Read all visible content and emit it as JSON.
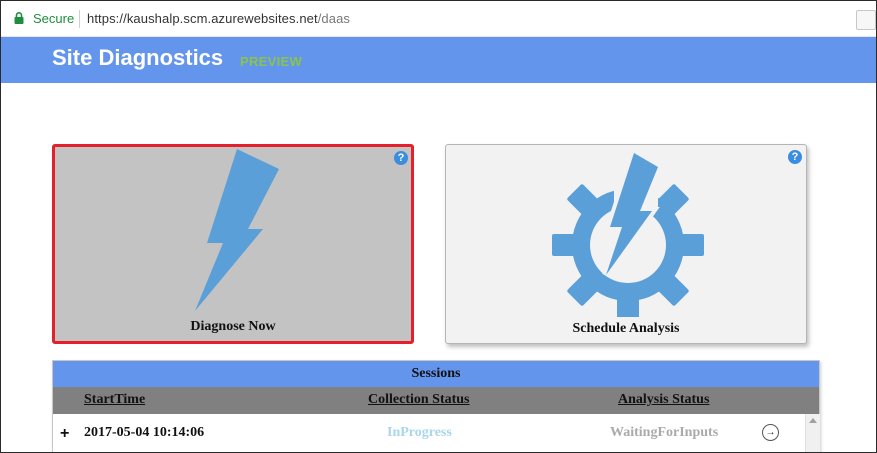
{
  "browser": {
    "secure_label": "Secure",
    "url_host": "https://kaushalp.scm.azurewebsites.net",
    "url_path": "/daas"
  },
  "header": {
    "title": "Site Diagnostics",
    "badge": "PREVIEW"
  },
  "cards": {
    "diagnose": {
      "label": "Diagnose Now",
      "help": "?",
      "icon": "lightning-bolt-icon"
    },
    "schedule": {
      "label": "Schedule Analysis",
      "help": "?",
      "icon": "gear-lightning-icon"
    }
  },
  "sessions": {
    "title": "Sessions",
    "columns": [
      "StartTime",
      "Collection Status",
      "Analysis Status"
    ],
    "rows": [
      {
        "expander": "+",
        "start_time": "2017-05-04 10:14:06",
        "collection_status": "InProgress",
        "analysis_status": "WaitingForInputs",
        "action": "→"
      }
    ]
  },
  "colors": {
    "header_bg": "#6495ed",
    "icon_blue": "#5a9fd8",
    "selected_border": "#e4202a",
    "preview_green": "#8bc34a",
    "secure_green": "#1e8e3e"
  }
}
